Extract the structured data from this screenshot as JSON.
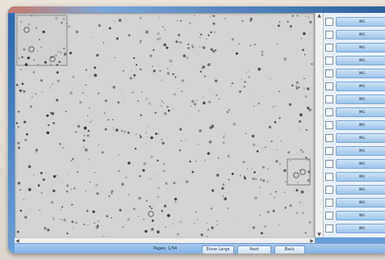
{
  "status": {
    "page_label": "Pages: 1/54",
    "buttons": [
      "Show Large",
      "Next",
      "Back"
    ]
  },
  "side_panel": {
    "rows": [
      "IMG",
      "IMG",
      "IMG",
      "IMG",
      "IMG",
      "IMG",
      "IMG",
      "IMG",
      "IMG",
      "IMG",
      "IMG",
      "IMG",
      "IMG",
      "IMG",
      "IMG",
      "IMG",
      "IMG"
    ]
  },
  "scroll": {
    "up": "▲",
    "down": "▼",
    "left": "◀",
    "right": "▶"
  },
  "colors": {
    "frame_blue": "#2d67ad",
    "panel_bg": "#e8f1fb",
    "viewer_bg": "#d3d3d3"
  }
}
